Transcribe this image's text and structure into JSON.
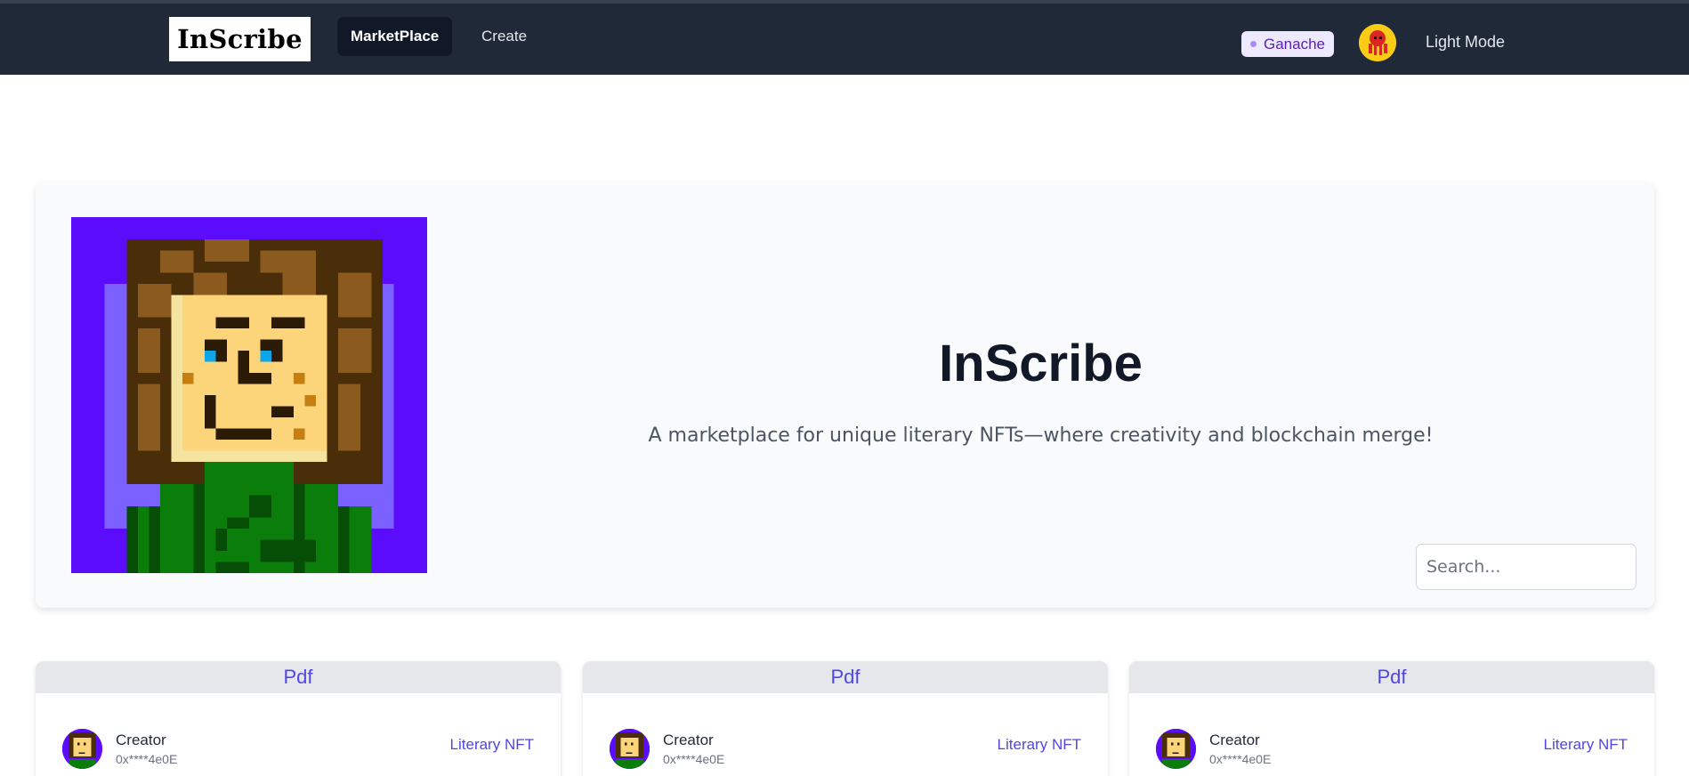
{
  "header": {
    "logo_text": "InScribe",
    "nav": [
      {
        "label": "MarketPlace",
        "active": true
      },
      {
        "label": "Create",
        "active": false
      }
    ],
    "network_label": "Ganache",
    "theme_toggle_label": "Light Mode",
    "profile_icon": "red-octopus-avatar"
  },
  "hero": {
    "image_icon": "pixel-art-person",
    "title": "InScribe",
    "subtitle": "A marketplace for unique literary NFTs—where creativity and blockchain merge!",
    "search": {
      "placeholder": "Search...",
      "value": ""
    }
  },
  "cards": [
    {
      "file_type": "Pdf",
      "creator_label": "Creator",
      "creator_address": "0x****4e0E",
      "tag": "Literary NFT"
    },
    {
      "file_type": "Pdf",
      "creator_label": "Creator",
      "creator_address": "0x****4e0E",
      "tag": "Literary NFT"
    },
    {
      "file_type": "Pdf",
      "creator_label": "Creator",
      "creator_address": "0x****4e0E",
      "tag": "Literary NFT"
    }
  ],
  "colors": {
    "nav_bg": "#1f2937",
    "accent": "#4f46e5",
    "network_bg": "#ede9fe",
    "hero_bg": "#f9fafb"
  }
}
